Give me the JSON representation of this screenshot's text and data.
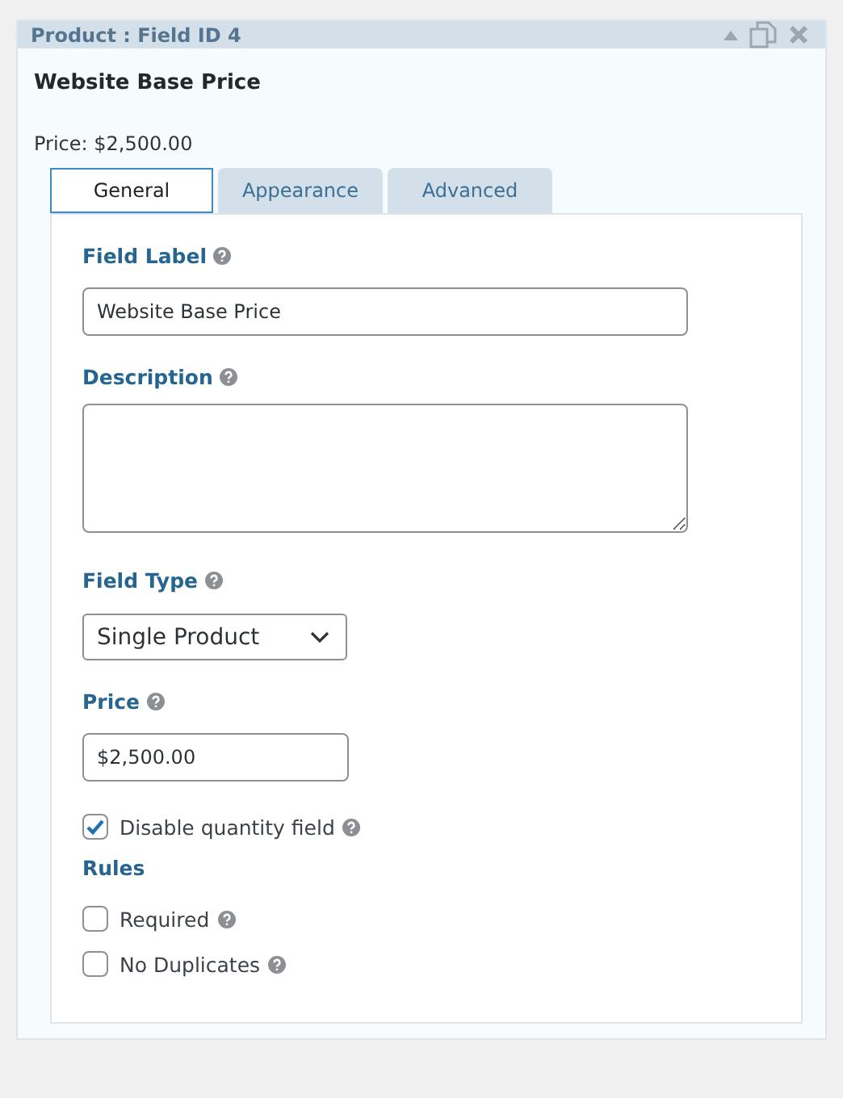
{
  "panel": {
    "title": "Product : Field ID 4"
  },
  "field_name": "Website Base Price",
  "summary": "Price: $2,500.00",
  "tabs": [
    {
      "label": "General",
      "selected": true
    },
    {
      "label": "Appearance",
      "selected": false
    },
    {
      "label": "Advanced",
      "selected": false
    }
  ],
  "form": [
    {
      "kind": "text",
      "label": "Field Label",
      "value": "Website Base Price"
    },
    {
      "kind": "textarea",
      "label": "Description"
    },
    {
      "kind": "select",
      "label": "Field Type",
      "value": "Single Product"
    },
    {
      "kind": "price",
      "label": "Price",
      "value": "$2,500.00"
    },
    {
      "kind": "checkbox",
      "label": "Disable quantity field",
      "checked": true
    },
    {
      "kind": "heading",
      "label": "Rules"
    },
    {
      "kind": "checkbox",
      "label": "Required",
      "checked": false
    },
    {
      "kind": "checkbox",
      "label": "No Duplicates",
      "checked": false
    }
  ]
}
